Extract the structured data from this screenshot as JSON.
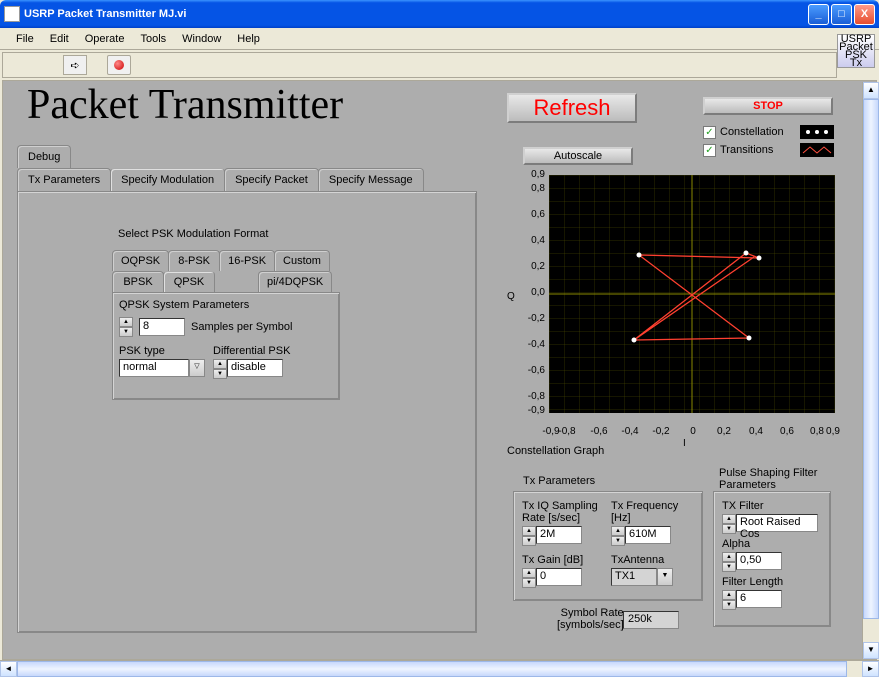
{
  "window": {
    "title": "USRP Packet Transmitter MJ.vi",
    "min": "_",
    "max": "□",
    "close": "X"
  },
  "menu": {
    "items": [
      "File",
      "Edit",
      "Operate",
      "Tools",
      "Window",
      "Help"
    ]
  },
  "toolbar": {
    "run_icon": "➪",
    "stop_icon": ""
  },
  "corner": {
    "line1": "USRP",
    "line2": "Packet",
    "line3": "PSK Tx"
  },
  "page_title": "Packet Transmitter",
  "tabs": {
    "debug": "Debug",
    "row": [
      "Tx Parameters",
      "Specify Modulation",
      "Specify Packet",
      "Specify Message"
    ],
    "active": 1
  },
  "mod": {
    "label": "Select PSK Modulation Format",
    "options_row1": [
      "OQPSK",
      "8-PSK",
      "16-PSK",
      "Custom"
    ],
    "options_row2": [
      "BPSK",
      "QPSK",
      "pi/4DQPSK"
    ],
    "active": "QPSK",
    "panel_title": "QPSK System Parameters",
    "samples_label": "Samples per Symbol",
    "samples_value": "8",
    "psk_type_label": "PSK type",
    "psk_type_value": "normal",
    "diff_label": "Differential PSK",
    "diff_value": "disable"
  },
  "buttons": {
    "refresh": "Refresh",
    "stop": "STOP",
    "autoscale": "Autoscale"
  },
  "legend": {
    "constellation": "Constellation",
    "transitions": "Transitions"
  },
  "graph": {
    "title": "Constellation Graph",
    "xlabel": "I",
    "ylabel": "Q",
    "ticks": [
      "-0,9",
      "-0,8",
      "-0,6",
      "-0,4",
      "-0,2",
      "0",
      "0,2",
      "0,4",
      "0,6",
      "0,8",
      "0,9"
    ],
    "yticks": [
      "0,9",
      "0,8",
      "0,6",
      "0,4",
      "0,2",
      "0,0",
      "-0,2",
      "-0,4",
      "-0,6",
      "-0,8",
      "-0,9"
    ]
  },
  "txp": {
    "title": "Tx Parameters",
    "iq_label": "Tx IQ Sampling Rate [s/sec]",
    "iq_value": "2M",
    "freq_label": "Tx Frequency [Hz]",
    "freq_value": "610M",
    "gain_label": "Tx Gain [dB]",
    "gain_value": "0",
    "ant_label": "TxAntenna",
    "ant_value": "TX1",
    "symrate_label": "Symbol Rate\n[symbols/sec]",
    "symrate_value": "250k"
  },
  "psf": {
    "title": "Pulse Shaping Filter\nParameters",
    "filter_label": "TX Filter",
    "filter_value": "Root Raised Cos",
    "alpha_label": "Alpha",
    "alpha_value": "0,50",
    "len_label": "Filter Length",
    "len_value": "6"
  },
  "chart_data": {
    "type": "scatter",
    "title": "Constellation Graph",
    "xlabel": "I",
    "ylabel": "Q",
    "xlim": [
      -0.9,
      0.9
    ],
    "ylim": [
      -0.9,
      0.9
    ],
    "series": [
      {
        "name": "Constellation",
        "x": [
          -0.4,
          -0.35,
          0.38,
          0.46,
          0.35
        ],
        "y": [
          -0.35,
          0.3,
          -0.34,
          0.27,
          0.28
        ],
        "style": "points"
      },
      {
        "name": "Transitions",
        "x": [
          -0.4,
          0.38,
          -0.35,
          0.46,
          0.35,
          -0.4
        ],
        "y": [
          -0.35,
          -0.34,
          0.3,
          0.27,
          0.28,
          -0.35
        ],
        "style": "lines"
      }
    ]
  }
}
